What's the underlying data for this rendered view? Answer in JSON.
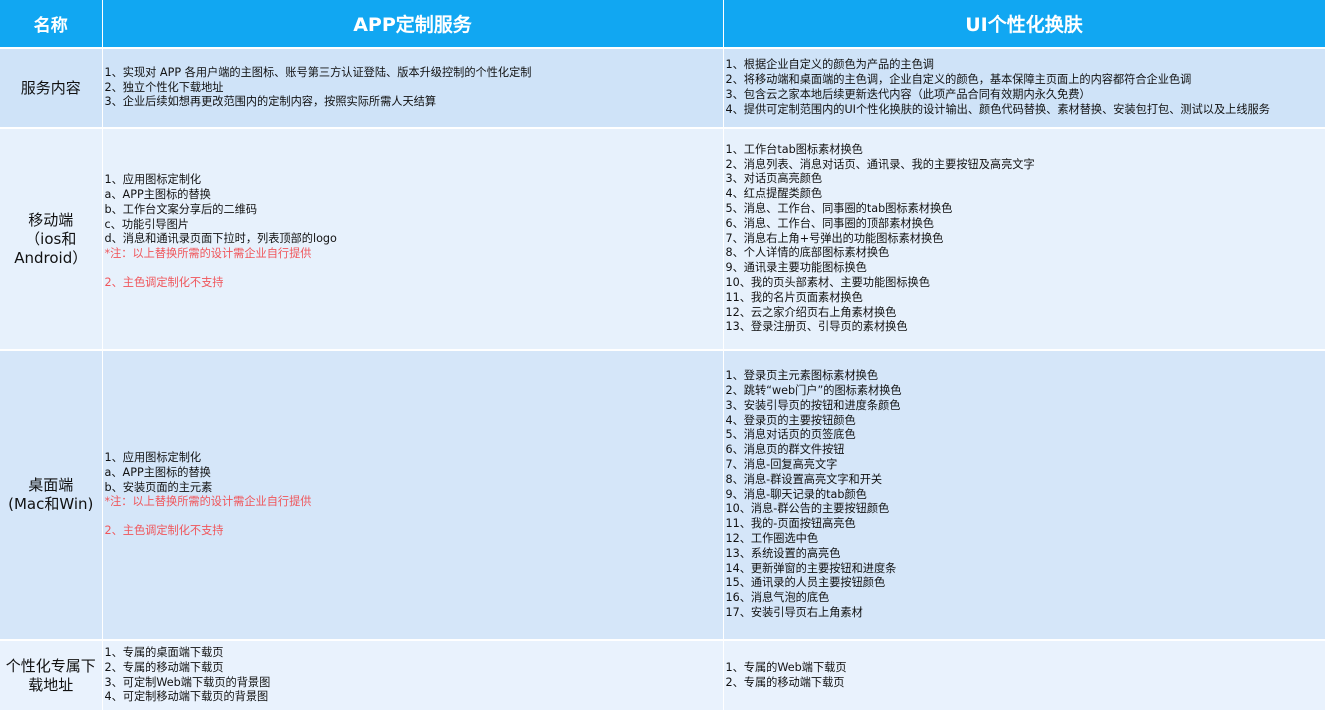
{
  "header": {
    "col_name": "名称",
    "col_app": "APP定制服务",
    "col_ui": "UI个性化换肤"
  },
  "rows": {
    "service": {
      "label": "服务内容",
      "app": [
        "1、实现对 APP 各用户端的主图标、账号第三方认证登陆、版本升级控制的个性化定制",
        "2、独立个性化下载地址",
        "3、企业后续如想再更改范围内的定制内容，按照实际所需人天结算"
      ],
      "ui": [
        "1、根据企业自定义的颜色为产品的主色调",
        "2、将移动端和桌面端的主色调，企业自定义的颜色，基本保障主页面上的内容都符合企业色调",
        "3、包含云之家本地后续更新迭代内容（此项产品合同有效期内永久免费）",
        "4、提供可定制范围内的UI个性化换肤的设计输出、颜色代码替换、素材替换、安装包打包、测试以及上线服务"
      ]
    },
    "mobile": {
      "label_1": "移动端",
      "label_2": "（ios和",
      "label_3": "Android）",
      "app": [
        "1、应用图标定制化",
        "a、APP主图标的替换",
        "b、工作台文案分享后的二维码",
        "c、功能引导图片",
        "d、消息和通讯录页面下拉时，列表顶部的logo"
      ],
      "app_note_1": "*注：以上替换所需的设计需企业自行提供",
      "app_note_2": "2、主色调定制化不支持",
      "ui": [
        "1、工作台tab图标素材换色",
        "2、消息列表、消息对话页、通讯录、我的主要按钮及高亮文字",
        "3、对话页高亮颜色",
        "4、红点提醒类颜色",
        "5、消息、工作台、同事圈的tab图标素材换色",
        "6、消息、工作台、同事圈的顶部素材换色",
        "7、消息右上角+号弹出的功能图标素材换色",
        "8、个人详情的底部图标素材换色",
        "9、通讯录主要功能图标换色",
        "10、我的页头部素材、主要功能图标换色",
        "11、我的名片页面素材换色",
        "12、云之家介绍页右上角素材换色",
        "13、登录注册页、引导页的素材换色"
      ]
    },
    "desktop": {
      "label_1": "桌面端",
      "label_2": "(Mac和Win)",
      "app": [
        "1、应用图标定制化",
        "a、APP主图标的替换",
        "b、安装页面的主元素"
      ],
      "app_note_1": "*注：以上替换所需的设计需企业自行提供",
      "app_note_2": "2、主色调定制化不支持",
      "ui": [
        "1、登录页主元素图标素材换色",
        "2、跳转“web门户”的图标素材换色",
        "3、安装引导页的按钮和进度条颜色",
        "4、登录页的主要按钮颜色",
        "5、消息对话页的页签底色",
        "6、消息页的群文件按钮",
        "7、消息-回复高亮文字",
        "8、消息-群设置高亮文字和开关",
        "9、消息-聊天记录的tab颜色",
        "10、消息-群公告的主要按钮颜色",
        "11、我的-页面按钮高亮色",
        "12、工作圈选中色",
        "13、系统设置的高亮色",
        "14、更新弹窗的主要按钮和进度条",
        "15、通讯录的人员主要按钮颜色",
        "16、消息气泡的底色",
        "17、安装引导页右上角素材"
      ]
    },
    "download": {
      "label_1": "个性化专属下",
      "label_2": "载地址",
      "app": [
        "1、专属的桌面端下载页",
        "2、专属的移动端下载页",
        "3、可定制Web端下载页的背景图",
        "4、可定制移动端下载页的背景图"
      ],
      "ui": [
        "1、专属的Web端下载页",
        "2、专属的移动端下载页"
      ]
    }
  }
}
